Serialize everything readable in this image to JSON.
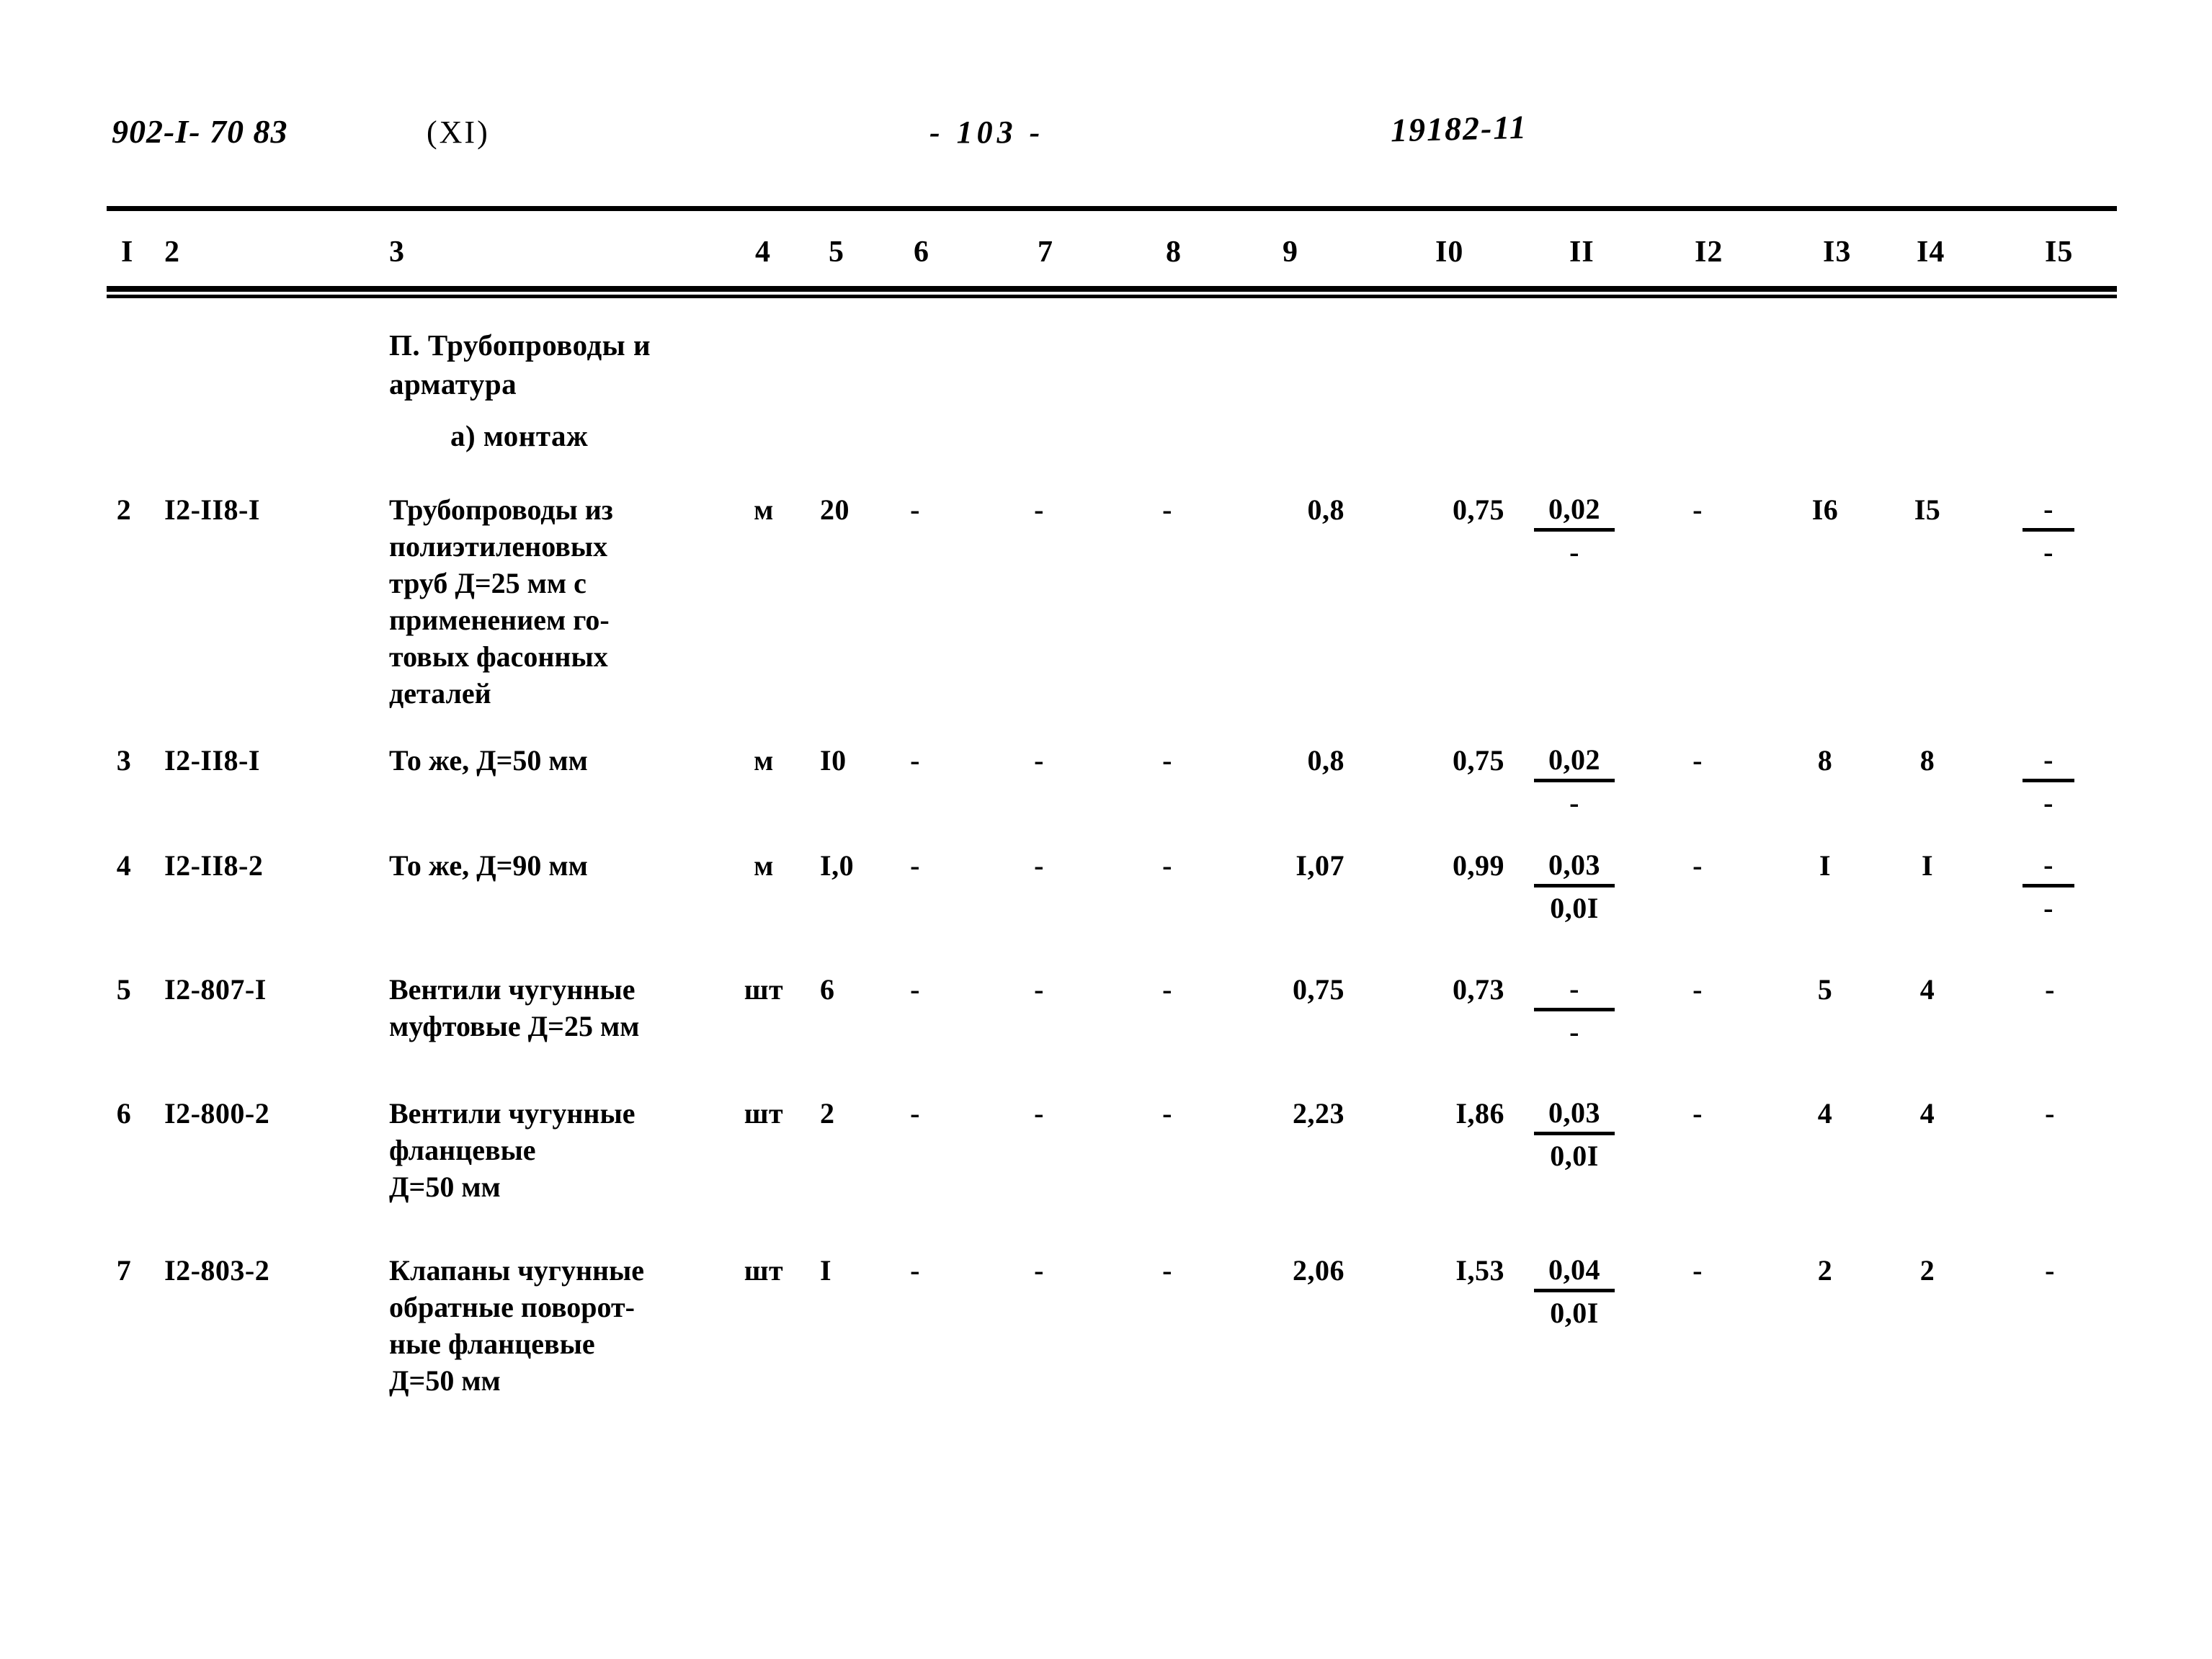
{
  "header": {
    "series_code": "902-I- 70 83",
    "part": "(XI)",
    "page_number": "- 103 -",
    "doc_number": "19182-11"
  },
  "table": {
    "column_headers": [
      "I",
      "2",
      "3",
      "4",
      "5",
      "6",
      "7",
      "8",
      "9",
      "I0",
      "II",
      "I2",
      "I3",
      "I4",
      "I5"
    ],
    "section_title": "П. Трубопроводы и\nарматура",
    "subsection_title": "а) монтаж",
    "rows": [
      {
        "no": "2",
        "code": "I2-II8-I",
        "desc": "Трубопроводы из\nполиэтиленовых\nтруб Д=25 мм с\nприменением го-\nтовых фасонных\nдеталей",
        "unit": "м",
        "c5": "20",
        "c6": "-",
        "c7": "-",
        "c8": "-",
        "c9": "0,8",
        "c10": "0,75",
        "c11_num": "0,02",
        "c11_den": "-",
        "c12": "-",
        "c13": "I6",
        "c14": "I5",
        "c15_num": "-",
        "c15_den": "-"
      },
      {
        "no": "3",
        "code": "I2-II8-I",
        "desc": "То же, Д=50 мм",
        "unit": "м",
        "c5": "I0",
        "c6": "-",
        "c7": "-",
        "c8": "-",
        "c9": "0,8",
        "c10": "0,75",
        "c11_num": "0,02",
        "c11_den": "-",
        "c12": "-",
        "c13": "8",
        "c14": "8",
        "c15_num": "-",
        "c15_den": "-"
      },
      {
        "no": "4",
        "code": "I2-II8-2",
        "desc": "То же, Д=90 мм",
        "unit": "м",
        "c5": "I,0",
        "c6": "-",
        "c7": "-",
        "c8": "-",
        "c9": "I,07",
        "c10": "0,99",
        "c11_num": "0,03",
        "c11_den": "0,0I",
        "c12": "-",
        "c13": "I",
        "c14": "I",
        "c15_num": "-",
        "c15_den": "-"
      },
      {
        "no": "5",
        "code": "I2-807-I",
        "desc": "Вентили чугунные\nмуфтовые Д=25 мм",
        "unit": "шт",
        "c5": "6",
        "c6": "-",
        "c7": "-",
        "c8": "-",
        "c9": "0,75",
        "c10": "0,73",
        "c11_num": "-",
        "c11_den": "-",
        "c12": "-",
        "c13": "5",
        "c14": "4",
        "c15_num": "-",
        "c15_den": ""
      },
      {
        "no": "6",
        "code": "I2-800-2",
        "desc": "Вентили чугунные\nфланцевые\nД=50 мм",
        "unit": "шт",
        "c5": "2",
        "c6": "-",
        "c7": "-",
        "c8": "-",
        "c9": "2,23",
        "c10": "I,86",
        "c11_num": "0,03",
        "c11_den": "0,0I",
        "c12": "-",
        "c13": "4",
        "c14": "4",
        "c15_num": "-",
        "c15_den": ""
      },
      {
        "no": "7",
        "code": "I2-803-2",
        "desc": "Клапаны чугунные\nобратные поворот-\nные фланцевые\nД=50 мм",
        "unit": "шт",
        "c5": "I",
        "c6": "-",
        "c7": "-",
        "c8": "-",
        "c9": "2,06",
        "c10": "I,53",
        "c11_num": "0,04",
        "c11_den": "0,0I",
        "c12": "-",
        "c13": "2",
        "c14": "2",
        "c15_num": "-",
        "c15_den": ""
      }
    ]
  }
}
